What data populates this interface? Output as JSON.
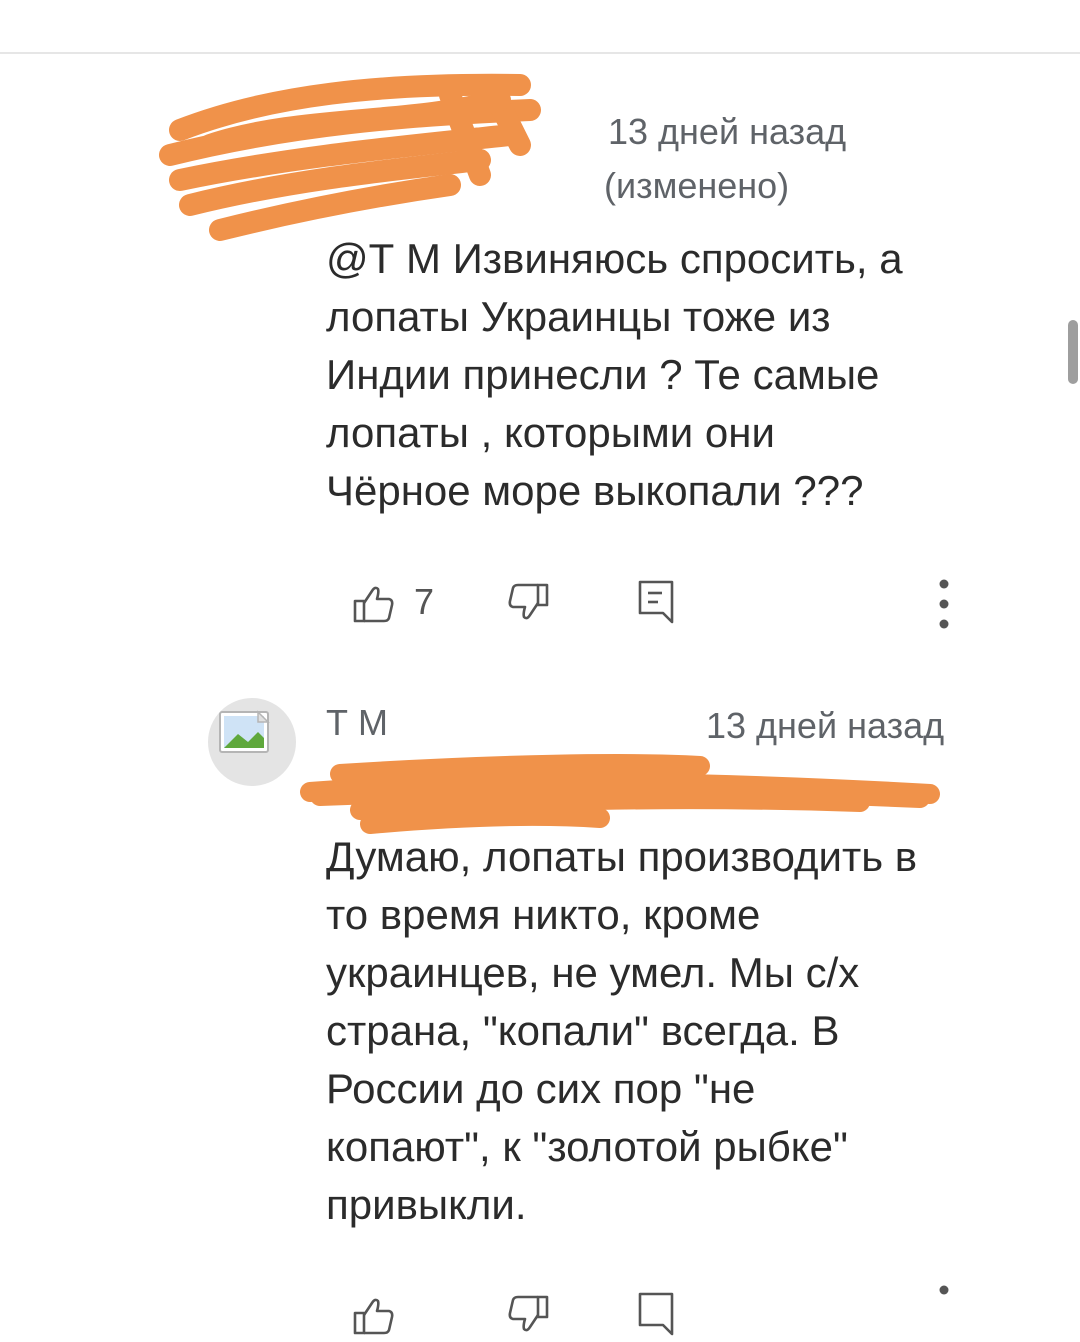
{
  "comments": [
    {
      "author": "",
      "time": "13 дней назад",
      "edited": "(изменено)",
      "text": " @Т М  Извиняюсь спросить, а\nлопаты Украинцы тоже из\nИндии принесли ? Те самые\nлопаты , которыми они\nЧёрное море выкопали ???",
      "likes": "7",
      "author_redacted": true
    },
    {
      "author": "Т М",
      "time": "13 дней назад",
      "mention": "",
      "text": "Думаю, лопаты производить в\nто время никто, кроме\nукраинцев, не умел. Мы с/х\nстрана, \"копали\" всегда. В\nРоссии до сих пор \"не\nкопают\", к \"золотой рыбке\"\nпривыкли.",
      "avatar_icon": "broken-image-icon",
      "mention_redacted": true
    }
  ],
  "icons": {
    "like": "thumbs-up-icon",
    "dislike": "thumbs-down-icon",
    "reply": "reply-icon",
    "more": "more-vertical-icon"
  },
  "colors": {
    "redaction": "#f0924a",
    "meta_text": "#5f6368",
    "body_text": "#2b2b2b"
  }
}
